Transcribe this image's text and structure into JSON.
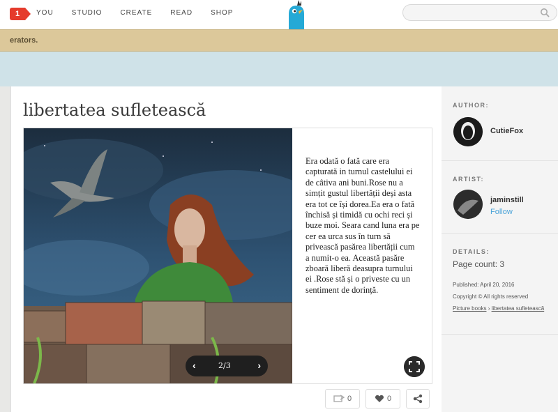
{
  "nav": {
    "badge_count": "1",
    "items": [
      "YOU",
      "STUDIO",
      "CREATE",
      "READ",
      "SHOP"
    ],
    "search_placeholder": ""
  },
  "banner": {
    "text": "erators."
  },
  "book": {
    "title": "libertatea sufletească",
    "story_text": "Era odată o fată care era capturată in turnul castelului ei de câtiva ani buni.Rose nu a simțit gustul libertății deși asta era tot ce își dorea.Ea era o fată închisă și timidă cu ochi reci și buze moi. Seara cand luna era pe cer ea urca sus în turn să privească  pasărea libertății cum a numit-o ea. Această pasăre zboară liberă deasupra turnului ei .Rose stă și o priveste cu un sentiment de dorință.",
    "pager": {
      "prev": "‹",
      "pages": "2/3",
      "next": "›"
    },
    "remix_count": "0",
    "like_count": "0"
  },
  "sidebar": {
    "author_label": "AUTHOR:",
    "author_name": "CutieFox",
    "artist_label": "ARTIST:",
    "artist_name": "jaminstill",
    "follow_label": "Follow",
    "details_label": "DETAILS:",
    "page_count": "Page count: 3",
    "published": "Published: April 20, 2016",
    "copyright": "Copyright © All rights reserved",
    "breadcrumb_category": "Picture books",
    "breadcrumb_sep": " › ",
    "breadcrumb_title": "libertatea sufletească"
  },
  "colors": {
    "accent": "#4aa3d8",
    "badge": "#e53b2c",
    "banner": "#dcc89a",
    "strip": "#cfe2e8"
  }
}
